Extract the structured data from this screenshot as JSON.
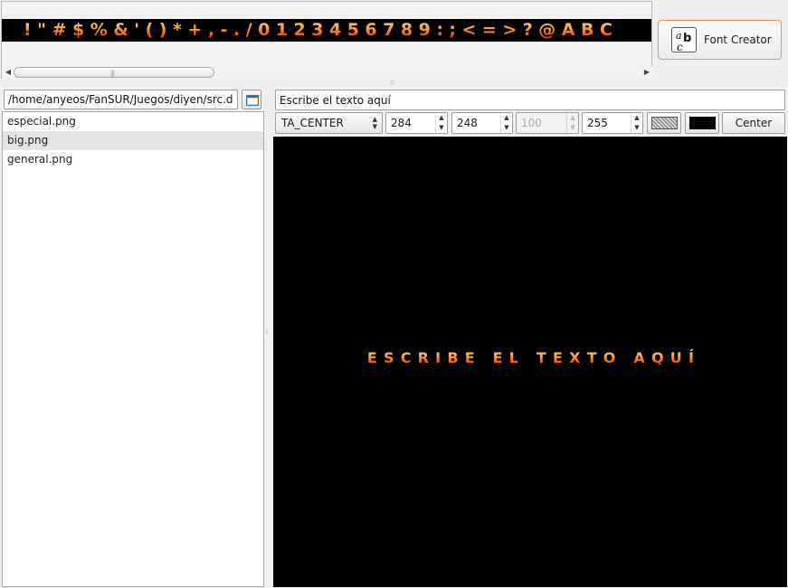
{
  "font_strip": {
    "glyphs": "!\"#$%&'()*+,-./0123456789:;<=>?@ABC"
  },
  "toolbar": {
    "font_creator_label": "Font Creator"
  },
  "browser": {
    "path_value": "/home/anyeos/FanSUR/Juegos/diyen/src.de",
    "files": [
      "especial.png",
      "big.png",
      "general.png"
    ],
    "selected_file": "big.png"
  },
  "editor": {
    "text_value": "Escribe el texto aquí",
    "align_value": "TA_CENTER",
    "x_value": "284",
    "y_value": "248",
    "disabled_value": "100",
    "alpha_value": "255",
    "center_label": "Center",
    "background_color": "#000000"
  },
  "preview": {
    "rendered_text": "ESCRIBE EL TEXTO AQUÍ"
  },
  "colors": {
    "accent_border": "#e1955f",
    "glyph_top": "#ffe27a",
    "glyph_mid": "#ff9a2c",
    "glyph_bottom": "#e0231c"
  }
}
